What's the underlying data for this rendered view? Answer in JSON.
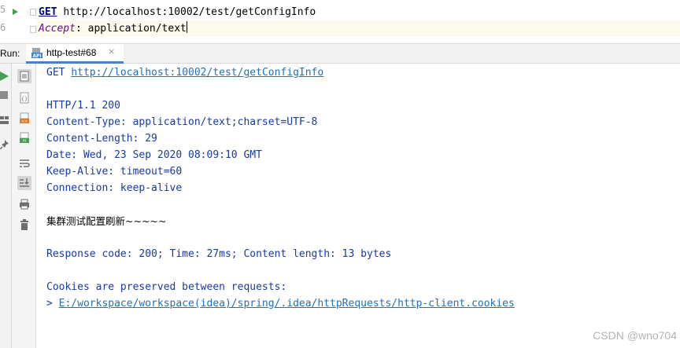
{
  "editor": {
    "lines": [
      {
        "number": "5",
        "method": "GET",
        "url": "http://localhost:10002/test/getConfigInfo"
      },
      {
        "number": "6",
        "header_key": "Accept",
        "header_sep": ": ",
        "header_value": "application/text"
      }
    ]
  },
  "run_panel": {
    "label": "Run:",
    "tab": {
      "label": "http-test#68",
      "icon": "api-file-icon",
      "close_glyph": "×"
    }
  },
  "left_toolbar": {
    "icons": [
      "rerun-icon",
      "stop-icon",
      "layout-icon",
      "pin-icon"
    ],
    "colors": {
      "rerun": "#499c54",
      "stop": "#8c8c8c"
    }
  },
  "side_toolbar": {
    "icons": [
      "response-file-icon",
      "json-file-icon",
      "html-file-icon",
      "http-file-icon",
      "soft-wrap-icon",
      "scroll-to-end-icon",
      "print-icon",
      "trash-icon"
    ]
  },
  "console": {
    "request_method": "GET",
    "request_url": "http://localhost:10002/test/getConfigInfo",
    "status_line": "HTTP/1.1 200",
    "headers": [
      "Content-Type: application/text;charset=UTF-8",
      "Content-Length: 29",
      "Date: Wed, 23 Sep 2020 08:09:10 GMT",
      "Keep-Alive: timeout=60",
      "Connection: keep-alive"
    ],
    "body": "集群测试配置刷新~~~~~",
    "summary": "Response code: 200; Time: 27ms; Content length: 13 bytes",
    "cookies_note": "Cookies are preserved between requests:",
    "cookies_prefix": "> ",
    "cookies_path": "E:/workspace/workspace(idea)/spring/.idea/httpRequests/http-client.cookies"
  },
  "watermark": "CSDN @wno704",
  "colors": {
    "console_text": "#1a3a9e",
    "link": "#2470b3",
    "tab_underline": "#4083c9",
    "current_line": "#fcfaed"
  }
}
